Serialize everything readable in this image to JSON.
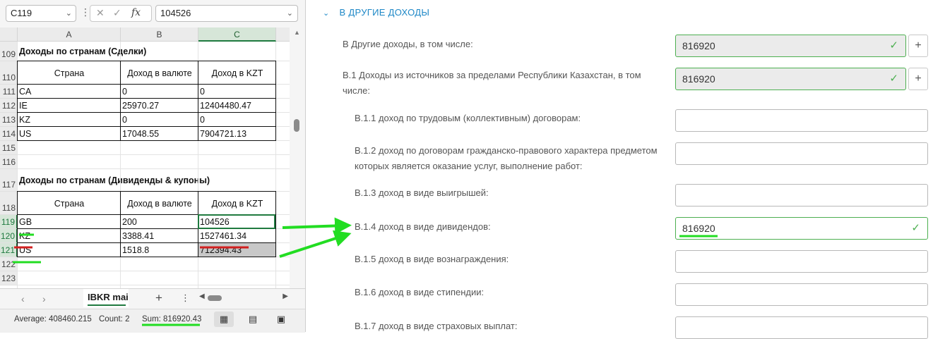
{
  "excel": {
    "name_box": "C119",
    "formula_value": "104526",
    "columns": [
      "A",
      "B",
      "C"
    ],
    "rows": [
      {
        "num": "109",
        "cells": [
          "Доходы по странам (Сделки)",
          "",
          ""
        ]
      },
      {
        "num": "110",
        "cells": [
          "Страна",
          "Доход в валюте",
          "Доход в KZT"
        ]
      },
      {
        "num": "111",
        "cells": [
          "CA",
          "0",
          "0"
        ]
      },
      {
        "num": "112",
        "cells": [
          "IE",
          "25970.27",
          "12404480.47"
        ]
      },
      {
        "num": "113",
        "cells": [
          "KZ",
          "0",
          "0"
        ]
      },
      {
        "num": "114",
        "cells": [
          "US",
          "17048.55",
          "7904721.13"
        ]
      },
      {
        "num": "115",
        "cells": [
          "",
          "",
          ""
        ]
      },
      {
        "num": "116",
        "cells": [
          "",
          "",
          ""
        ]
      },
      {
        "num": "117",
        "cells": [
          "Доходы по странам (Дивиденды & купоны)",
          "",
          ""
        ]
      },
      {
        "num": "118",
        "cells": [
          "Страна",
          "Доход в валюте",
          "Доход в KZT"
        ]
      },
      {
        "num": "119",
        "cells": [
          "GB",
          "200",
          "104526"
        ]
      },
      {
        "num": "120",
        "cells": [
          "KZ",
          "3388.41",
          "1527461.34"
        ]
      },
      {
        "num": "121",
        "cells": [
          "US",
          "1518.8",
          "712394.43"
        ]
      },
      {
        "num": "122",
        "cells": [
          "",
          "",
          ""
        ]
      },
      {
        "num": "123",
        "cells": [
          "",
          "",
          ""
        ]
      }
    ],
    "sheet_tab": "IBKR mai",
    "status": {
      "average": "Average: 408460.215",
      "count": "Count: 2",
      "sum": "Sum: 816920.43"
    }
  },
  "form": {
    "section_title": "В ДРУГИЕ ДОХОДЫ",
    "fields": [
      {
        "label": "В Другие доходы, в том числе:",
        "value": "816920"
      },
      {
        "label": "В.1 Доходы из источников за пределами Республики Казахстан, в том числе:",
        "value": "816920"
      },
      {
        "label": "В.1.1 доход по трудовым (коллективным) договорам:",
        "value": ""
      },
      {
        "label": "В.1.2 доход по договорам гражданско-правового характера предметом которых является оказание услуг, выполнение работ:",
        "value": ""
      },
      {
        "label": "В.1.3 доход в виде выигрышей:",
        "value": ""
      },
      {
        "label": "В.1.4 доход в виде дивидендов:",
        "value": "816920"
      },
      {
        "label": "В.1.5 доход в виде вознаграждения:",
        "value": ""
      },
      {
        "label": "В.1.6 доход в виде стипендии:",
        "value": ""
      },
      {
        "label": "В.1.7 доход в виде страховых выплат:",
        "value": ""
      }
    ],
    "add_label": "+",
    "check_glyph": "✓"
  },
  "colors": {
    "annotation_green": "#22dd22",
    "annotation_red": "#d11f1f",
    "excel_green": "#1f7a3f",
    "link_blue": "#1e88c7"
  }
}
